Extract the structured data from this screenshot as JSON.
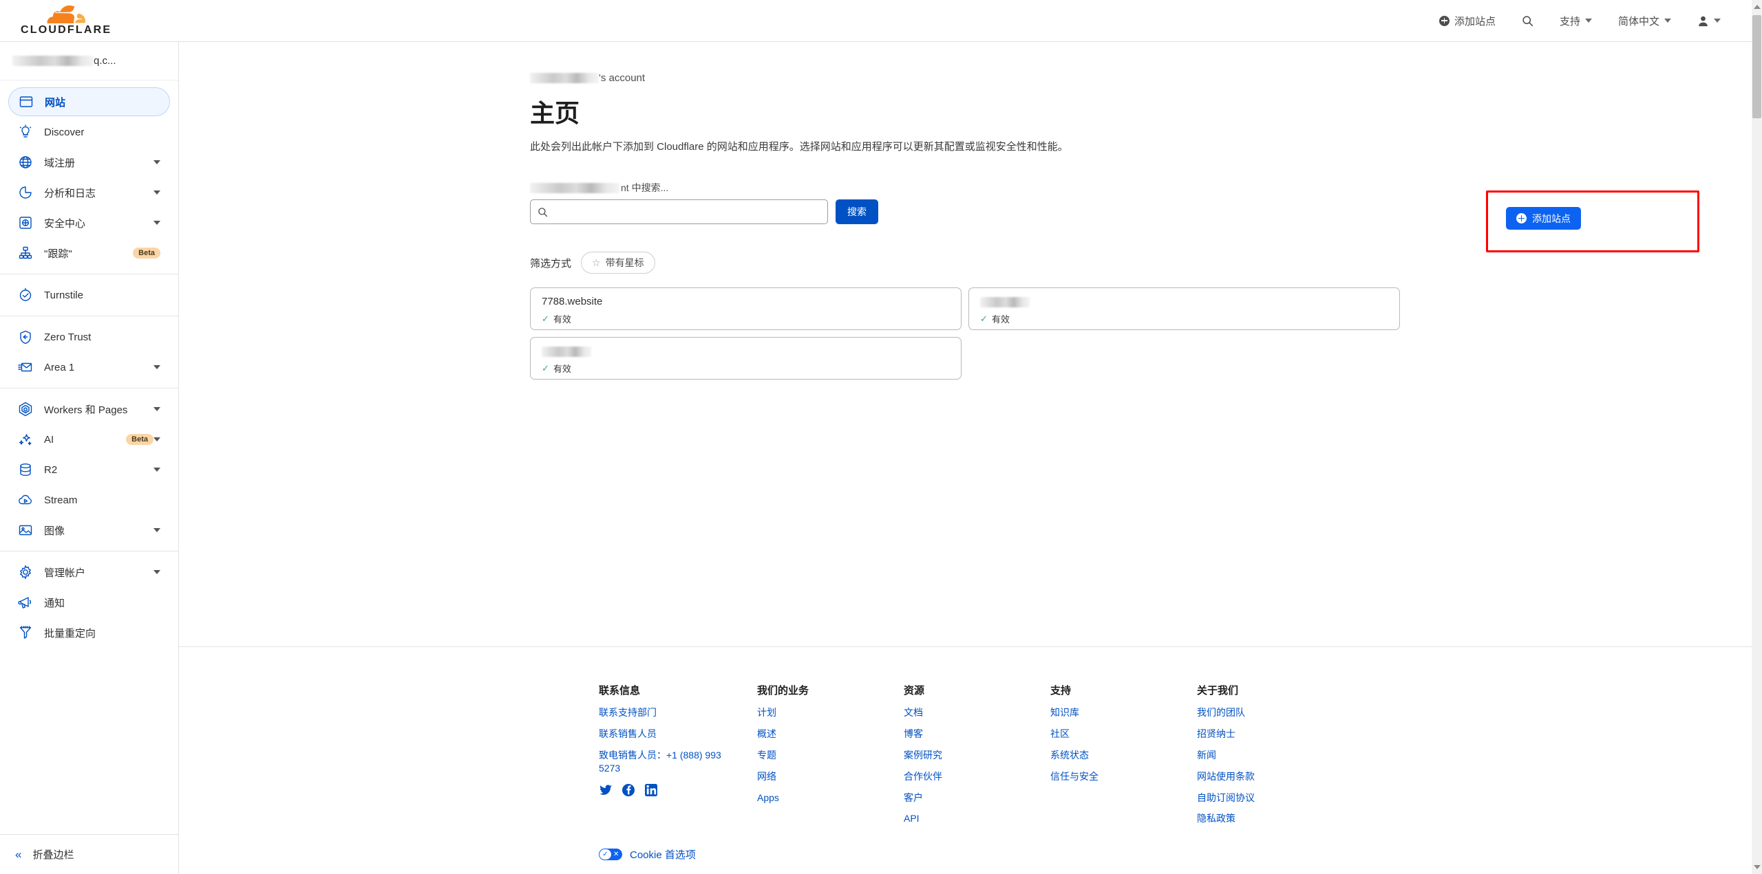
{
  "brand": {
    "name": "CLOUDFLARE",
    "logo_icon": "cloudflare-cloud-icon"
  },
  "topbar": {
    "add_site": "添加站点",
    "search_icon": "search-icon",
    "support": "支持",
    "language": "简体中文",
    "account_icon": "person-icon"
  },
  "sidebar": {
    "account_name": "q.c...",
    "collapse_label": "折叠边栏",
    "items": [
      {
        "label": "网站",
        "icon": "window-icon",
        "active": true,
        "caret": false,
        "badge": ""
      },
      {
        "label": "Discover",
        "icon": "lightbulb-icon",
        "active": false,
        "caret": false,
        "badge": ""
      },
      {
        "label": "域注册",
        "icon": "globe-icon",
        "active": false,
        "caret": true,
        "badge": ""
      },
      {
        "label": "分析和日志",
        "icon": "pie-chart-icon",
        "active": false,
        "caret": true,
        "badge": ""
      },
      {
        "label": "安全中心",
        "icon": "shield-grid-icon",
        "active": false,
        "caret": true,
        "badge": ""
      },
      {
        "label": "\"跟踪\"",
        "icon": "sitemap-icon",
        "active": false,
        "caret": false,
        "badge": "Beta"
      },
      {
        "separator": true
      },
      {
        "label": "Turnstile",
        "icon": "turnstile-icon",
        "active": false,
        "caret": false,
        "badge": ""
      },
      {
        "separator": true
      },
      {
        "label": "Zero Trust",
        "icon": "zero-trust-shield-icon",
        "active": false,
        "caret": false,
        "badge": ""
      },
      {
        "label": "Area 1",
        "icon": "envelope-icon",
        "active": false,
        "caret": true,
        "badge": ""
      },
      {
        "separator": true
      },
      {
        "label": "Workers 和 Pages",
        "icon": "workers-icon",
        "active": false,
        "caret": true,
        "badge": ""
      },
      {
        "label": "AI",
        "icon": "ai-sparkle-icon",
        "active": false,
        "caret": true,
        "badge": "Beta"
      },
      {
        "label": "R2",
        "icon": "database-icon",
        "active": false,
        "caret": true,
        "badge": ""
      },
      {
        "label": "Stream",
        "icon": "stream-cloud-icon",
        "active": false,
        "caret": false,
        "badge": ""
      },
      {
        "label": "图像",
        "icon": "image-icon",
        "active": false,
        "caret": true,
        "badge": ""
      },
      {
        "separator": true
      },
      {
        "label": "管理帐户",
        "icon": "gear-icon",
        "active": false,
        "caret": true,
        "badge": ""
      },
      {
        "label": "通知",
        "icon": "megaphone-icon",
        "active": false,
        "caret": false,
        "badge": ""
      },
      {
        "label": "批量重定向",
        "icon": "funnel-icon",
        "active": false,
        "caret": false,
        "badge": ""
      }
    ]
  },
  "main": {
    "breadcrumb_suffix": "'s account",
    "page_title": "主页",
    "page_description": "此处会列出此帐户下添加到 Cloudflare 的网站和应用程序。选择网站和应用程序可以更新其配置或监视安全性和性能。",
    "search": {
      "label_suffix": "nt 中搜索...",
      "label_prefix_redacted": true,
      "value": "",
      "placeholder": "",
      "button_label": "搜索",
      "icon": "search-icon"
    },
    "filter": {
      "label": "筛选方式",
      "starred_pill": "带有星标",
      "star_icon": "star-outline-icon"
    },
    "add_site_button": {
      "label": "添加站点",
      "icon": "plus-circle-icon"
    },
    "cards": [
      {
        "title": "7788.website",
        "redacted": false,
        "status": "有效",
        "status_icon": "check-icon"
      },
      {
        "title": "",
        "redacted": true,
        "status": "有效",
        "status_icon": "check-icon"
      },
      {
        "title": "",
        "redacted": true,
        "status": "有效",
        "status_icon": "check-icon"
      }
    ]
  },
  "footer": {
    "columns": [
      {
        "heading": "联系信息",
        "links": [
          "联系支持部门",
          "联系销售人员",
          "致电销售人员：+1 (888) 993 5273"
        ],
        "socials": [
          "twitter-icon",
          "facebook-icon",
          "linkedin-icon"
        ]
      },
      {
        "heading": "我们的业务",
        "links": [
          "计划",
          "概述",
          "专题",
          "网络",
          "Apps"
        ],
        "socials": []
      },
      {
        "heading": "资源",
        "links": [
          "文档",
          "博客",
          "案例研究",
          "合作伙伴",
          "客户",
          "API"
        ],
        "socials": []
      },
      {
        "heading": "支持",
        "links": [
          "知识库",
          "社区",
          "系统状态",
          "信任与安全"
        ],
        "socials": []
      },
      {
        "heading": "关于我们",
        "links": [
          "我们的团队",
          "招贤纳士",
          "新闻",
          "网站使用条款",
          "自助订阅协议",
          "隐私政策"
        ],
        "socials": []
      }
    ],
    "cookie_label": "Cookie 首选项",
    "cookie_icon": "cookie-toggle-icon"
  },
  "colors": {
    "brand_orange": "#f6821f",
    "primary_blue": "#0051c3",
    "button_blue": "#0d63f1",
    "success_green": "#46a758",
    "highlight_red": "#ff0000"
  }
}
